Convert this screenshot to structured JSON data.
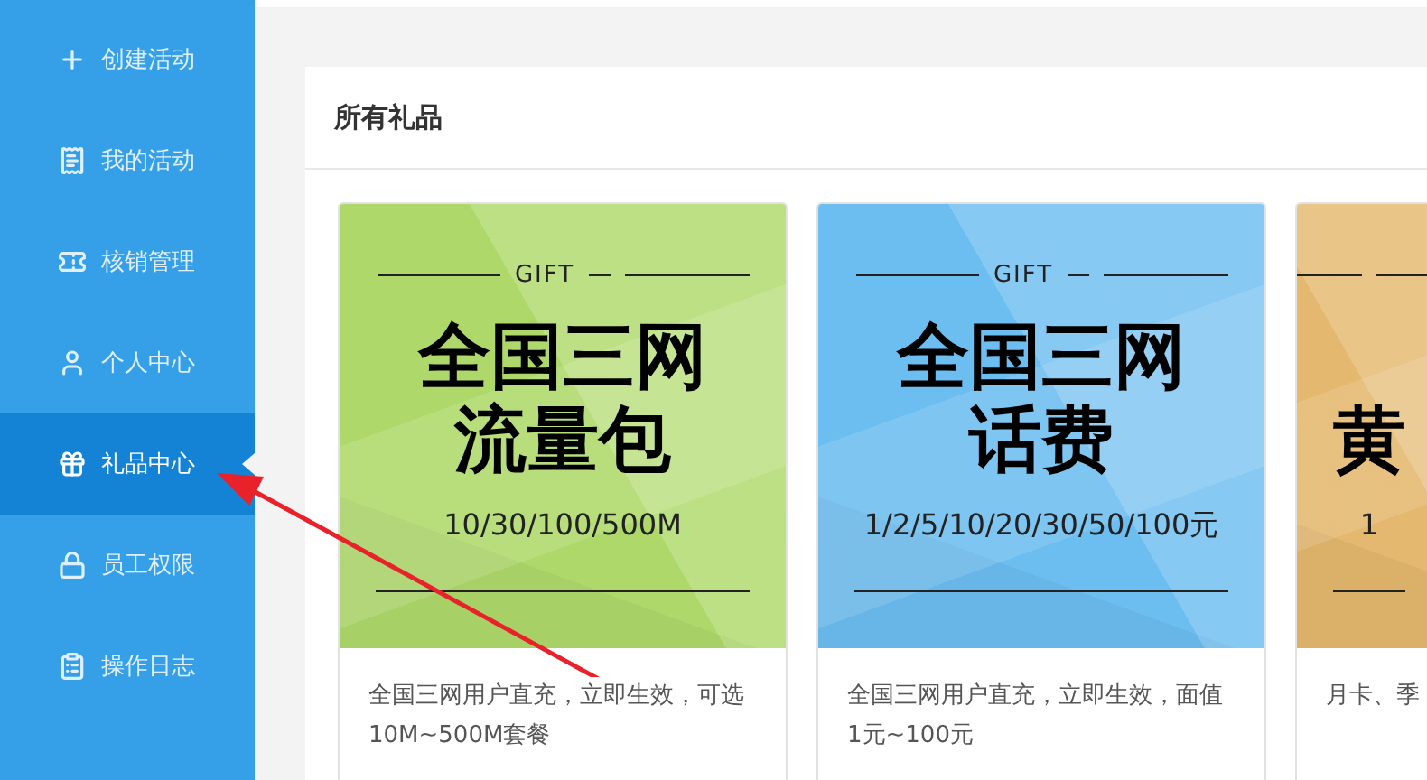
{
  "sidebar": {
    "items": [
      {
        "label": "创建活动",
        "selected": false
      },
      {
        "label": "我的活动",
        "selected": false
      },
      {
        "label": "核销管理",
        "selected": false
      },
      {
        "label": "个人中心",
        "selected": false
      },
      {
        "label": "礼品中心",
        "selected": true
      },
      {
        "label": "员工权限",
        "selected": false
      },
      {
        "label": "操作日志",
        "selected": false
      }
    ]
  },
  "panel": {
    "title": "所有礼品",
    "gifts": [
      {
        "color": "#aed96a",
        "tag": "GIFT",
        "title": [
          "全国三网",
          "流量包"
        ],
        "subtitle": "10/30/100/500M",
        "description": "全国三网用户直充，立即生效，可选10M~500M套餐"
      },
      {
        "color": "#6cbdf0",
        "tag": "GIFT",
        "title": [
          "全国三网",
          "话费"
        ],
        "subtitle": "1/2/5/10/20/30/50/100元",
        "description": "全国三网用户直充，立即生效，面值1元~100元"
      },
      {
        "color": "#e4b86e",
        "title": [
          "黄"
        ],
        "subtitle": "1",
        "description": "月卡、季"
      }
    ]
  }
}
